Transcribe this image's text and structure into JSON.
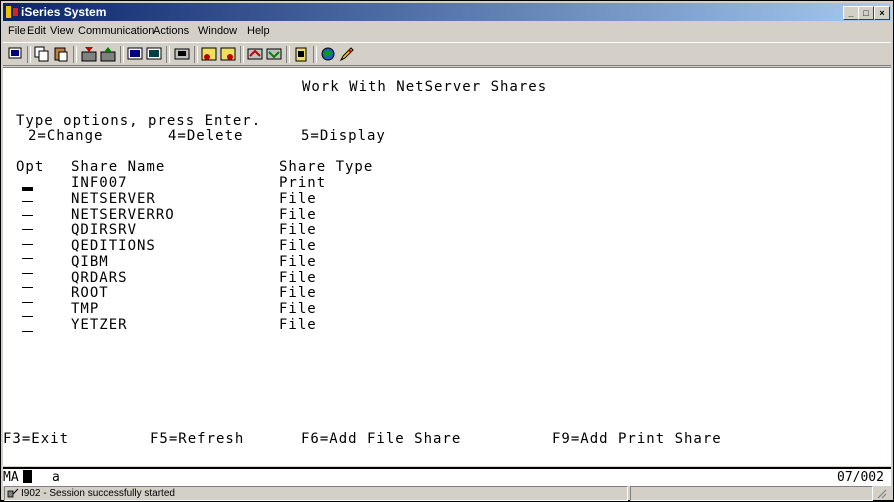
{
  "window": {
    "title": "iSeries System"
  },
  "menu": [
    "File",
    "Edit",
    "View",
    "Communication",
    "Actions",
    "Window",
    "Help"
  ],
  "toolbar_icons": [
    "print-screen-icon",
    "copy-icon",
    "paste-icon",
    "send-icon",
    "receive-icon",
    "display-icon",
    "record-icon",
    "macro-icon",
    "play-icon",
    "stop-icon",
    "keyboard-icon",
    "color-icon",
    "clipboard-icon",
    "globe-icon",
    "edit-icon"
  ],
  "screen": {
    "title": "Work With NetServer Shares",
    "instruction": "Type options, press Enter.",
    "options": [
      "2=Change",
      "4=Delete",
      "5=Display"
    ],
    "headers": {
      "opt": "Opt",
      "share_name": "Share Name",
      "share_type": "Share Type"
    },
    "rows": [
      {
        "name": "INF007",
        "type": "Print"
      },
      {
        "name": "NETSERVER",
        "type": "File"
      },
      {
        "name": "NETSERVERRO",
        "type": "File"
      },
      {
        "name": "QDIRSRV",
        "type": "File"
      },
      {
        "name": "QEDITIONS",
        "type": "File"
      },
      {
        "name": "QIBM",
        "type": "File"
      },
      {
        "name": "QRDARS",
        "type": "File"
      },
      {
        "name": "ROOT",
        "type": "File"
      },
      {
        "name": "TMP",
        "type": "File"
      },
      {
        "name": "YETZER",
        "type": "File"
      }
    ],
    "fkeys": [
      "F3=Exit",
      "F5=Refresh",
      "F6=Add File Share",
      "F9=Add Print Share"
    ]
  },
  "oia": {
    "mode": "MA",
    "field": "a",
    "position": "07/002"
  },
  "status": {
    "message": "I902 - Session successfully started"
  },
  "colors": {
    "titlebar_start": "#0a246a",
    "titlebar_end": "#a6caf0",
    "chrome": "#d4d0c8",
    "screen_bg": "#ffffff"
  }
}
